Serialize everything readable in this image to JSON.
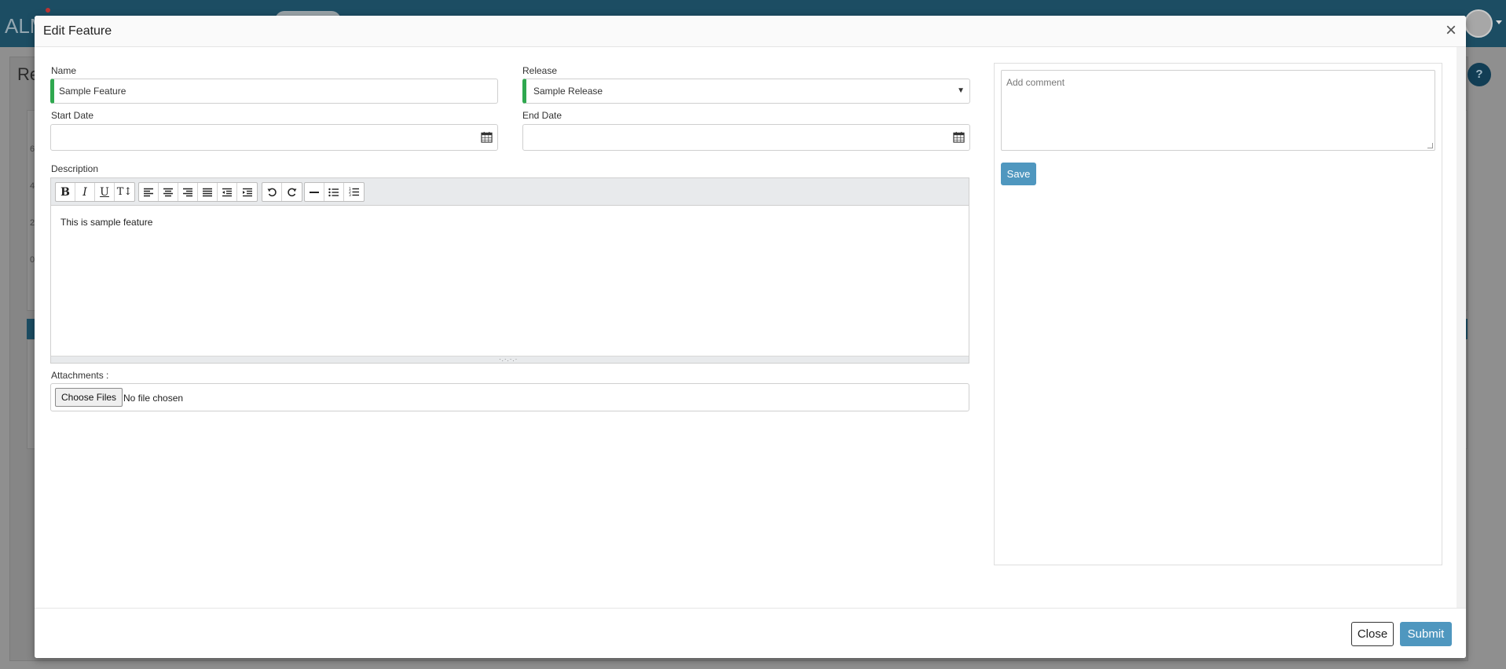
{
  "background": {
    "logo_text": "ALM",
    "page_title": "Re",
    "axis_numbers": [
      "6",
      "4",
      "2",
      "0"
    ],
    "help_icon": "?"
  },
  "modal": {
    "title": "Edit Feature",
    "close_icon": "×",
    "fields": {
      "name": {
        "label": "Name",
        "value": "Sample Feature"
      },
      "release": {
        "label": "Release",
        "value": "Sample Release"
      },
      "start_date": {
        "label": "Start Date",
        "value": ""
      },
      "end_date": {
        "label": "End Date",
        "value": ""
      },
      "description": {
        "label": "Description",
        "value": "This is sample feature"
      },
      "attachments": {
        "label": "Attachments :",
        "button": "Choose Files",
        "status": "No file chosen"
      }
    },
    "toolbar": {
      "bold": "B",
      "italic": "I",
      "underline": "U",
      "font_size": "T↕",
      "icons": [
        "bold-icon",
        "italic-icon",
        "underline-icon",
        "font-size-icon",
        "align-left-icon",
        "align-center-icon",
        "align-right-icon",
        "justify-icon",
        "outdent-icon",
        "indent-icon",
        "undo-icon",
        "redo-icon",
        "horizontal-rule-icon",
        "bullet-list-icon",
        "numbered-list-icon"
      ]
    },
    "comment": {
      "placeholder": "Add comment",
      "save_label": "Save"
    },
    "footer": {
      "close_label": "Close",
      "submit_label": "Submit"
    }
  },
  "colors": {
    "required_indicator": "#2fa84f",
    "primary_button": "#4f97bf",
    "topbar": "#1c4d63"
  }
}
